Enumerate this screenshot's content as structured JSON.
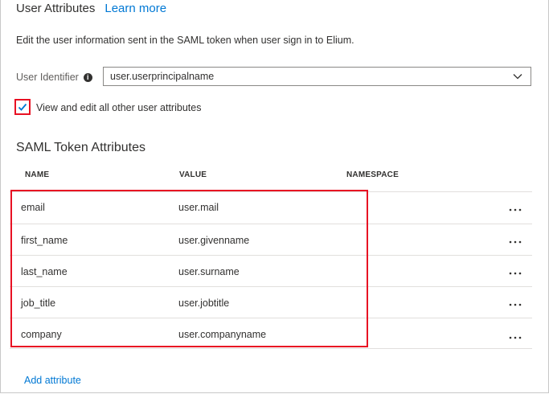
{
  "header": {
    "title": "User Attributes",
    "learn_more": "Learn more"
  },
  "description": "Edit the user information sent in the SAML token when user sign in to Elium.",
  "user_identifier": {
    "label": "User Identifier",
    "value": "user.userprincipalname"
  },
  "view_edit": {
    "label": "View and edit all other user attributes",
    "checked": true
  },
  "saml": {
    "title": "SAML Token Attributes",
    "columns": {
      "name": "NAME",
      "value": "VALUE",
      "namespace": "NAMESPACE"
    },
    "rows": [
      {
        "name": "email",
        "value": "user.mail",
        "namespace": ""
      },
      {
        "name": "first_name",
        "value": "user.givenname",
        "namespace": ""
      },
      {
        "name": "last_name",
        "value": "user.surname",
        "namespace": ""
      },
      {
        "name": "job_title",
        "value": "user.jobtitle",
        "namespace": ""
      },
      {
        "name": "company",
        "value": "user.companyname",
        "namespace": ""
      }
    ],
    "more_label": "..."
  },
  "add_attribute": "Add attribute",
  "colors": {
    "accent": "#0078d4",
    "highlight": "#e81123"
  }
}
